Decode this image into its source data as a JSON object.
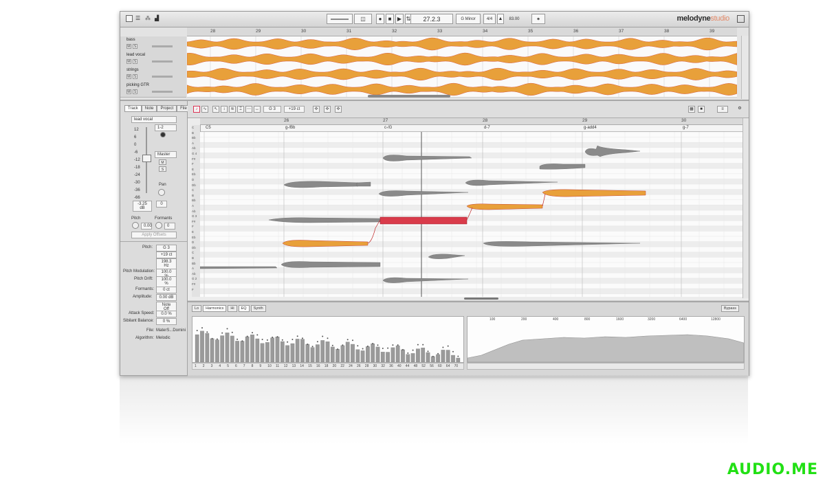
{
  "app": {
    "logo_main": "melodyne",
    "logo_sub": "studio"
  },
  "transport": {
    "position": "27.2.3",
    "key": "G Minor",
    "meter": "4/4",
    "tempo": "83.00"
  },
  "arrangement": {
    "bars": [
      "28",
      "29",
      "30",
      "31",
      "32",
      "33",
      "34",
      "35",
      "36",
      "37",
      "38",
      "39"
    ],
    "tracks": [
      {
        "name": "bass"
      },
      {
        "name": "lead vocal"
      },
      {
        "name": "strings"
      },
      {
        "name": "picking GTR"
      }
    ],
    "mute": "M",
    "solo": "S"
  },
  "inspector": {
    "tabs": [
      "Track",
      "Note",
      "Project",
      "File"
    ],
    "track_name": "lead vocal",
    "channel": "1-2",
    "output": "Master",
    "scale": [
      "12",
      "6",
      "0",
      "-6",
      "-12",
      "-18",
      "-24",
      "-30",
      "-36",
      "-66"
    ],
    "volume_db": "-3.25 dB",
    "pan_value": "0",
    "pan_label": "Pan",
    "pitch_label": "Pitch",
    "formants_label": "Formants",
    "pitch_val": "0.00",
    "formants_val": "0",
    "apply_offsets": "Apply Offsets",
    "note_pitch_label": "Pitch:",
    "note_pitch": "G 3",
    "note_cents": "+19 ct",
    "note_hz": "198.3 Hz",
    "pitch_mod_label": "Pitch Modulation:",
    "pitch_mod": "100.0 %",
    "pitch_drift_label": "Pitch Drift:",
    "pitch_drift": "100.0 %",
    "formants2_label": "Formants:",
    "formants2": "0 ct",
    "amplitude_label": "Amplitude:",
    "amplitude": "0.00 dB",
    "note_off": "Note Off",
    "attack_label": "Attack Speed:",
    "attack": "0.0 %",
    "sibilant_label": "Sibilant Balance:",
    "sibilant": "0 %",
    "file_label": "File:",
    "file": "MaterS...Domini",
    "algorithm_label": "Algorithm:",
    "algorithm": "Melodic"
  },
  "editor": {
    "pitch_field": "G 3",
    "cents_field": "+19 ct",
    "bars": [
      "26",
      "27",
      "28",
      "29",
      "30"
    ],
    "chords": [
      {
        "label": "C5"
      },
      {
        "label": "g-/Bb"
      },
      {
        "label": "c-/G"
      },
      {
        "label": "d-7"
      },
      {
        "label": "g-add4"
      },
      {
        "label": "g-7"
      }
    ],
    "keys": [
      "C",
      "B",
      "Bb",
      "A",
      "Ab",
      "G 4",
      "F#",
      "F",
      "E",
      "Eb",
      "D",
      "Db",
      "C",
      "B",
      "Bb",
      "A",
      "Ab",
      "G 3",
      "F#",
      "F",
      "E",
      "Eb",
      "D",
      "Db",
      "C",
      "B",
      "Bb",
      "A",
      "Ab",
      "G 2",
      "F#",
      "F"
    ]
  },
  "sound": {
    "tabs": [
      "Lo",
      "Harmonics",
      "Hi",
      "EQ",
      "Synth"
    ],
    "bypass": "Bypass",
    "harm_ticks": [
      "1",
      "2",
      "3",
      "4",
      "5",
      "6",
      "7",
      "8",
      "9",
      "10",
      "11",
      "12",
      "13",
      "14",
      "15",
      "16",
      "18",
      "20",
      "22",
      "24",
      "26",
      "28",
      "30",
      "32",
      "36",
      "40",
      "44",
      "48",
      "52",
      "56",
      "60",
      "64",
      "70"
    ],
    "freqs": [
      "100",
      "200",
      "400",
      "800",
      "1600",
      "3200",
      "6400",
      "12800"
    ]
  },
  "colors": {
    "accent": "#d93b4a",
    "wave": "#e8a03a",
    "blob": "#8a8a8a"
  }
}
